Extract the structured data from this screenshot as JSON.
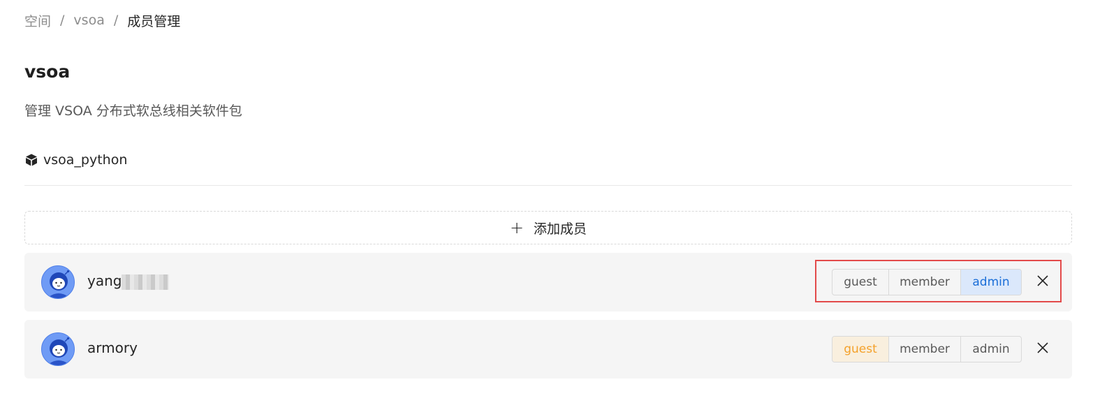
{
  "breadcrumb": {
    "items": [
      "空间",
      "vsoa",
      "成员管理"
    ],
    "separator": "/"
  },
  "space": {
    "title": "vsoa",
    "description": "管理 VSOA 分布式软总线相关软件包"
  },
  "package": {
    "icon": "cube-icon",
    "name": "vsoa_python"
  },
  "add_member": {
    "icon": "plus-icon",
    "label": "添加成员"
  },
  "members": [
    {
      "username": "yang",
      "username_obscured": true,
      "avatar": "robot-avatar",
      "roles": [
        "guest",
        "member",
        "admin"
      ],
      "selected_role": "admin",
      "remove_icon": "close-icon"
    },
    {
      "username": "armory",
      "username_obscured": false,
      "avatar": "robot-avatar",
      "roles": [
        "guest",
        "member",
        "admin"
      ],
      "selected_role": "guest",
      "remove_icon": "close-icon"
    }
  ],
  "colors": {
    "admin_active_bg": "#dbe8fb",
    "admin_active_text": "#1a6ed8",
    "guest_active_bg": "#f9efde",
    "guest_active_text": "#f4a12a",
    "highlight_border": "#e34a4a",
    "card_bg": "#f5f5f5"
  }
}
